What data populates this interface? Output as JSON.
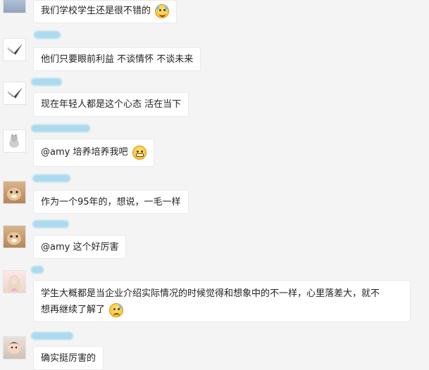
{
  "chat": {
    "messages": [
      {
        "text": "我们学校学生还是很不错的",
        "emoji": "laughing-tears-emoji",
        "avatar": "avatar-partial"
      },
      {
        "text": "他们只要眼前利益 不谈情怀 不谈未来",
        "avatar": "swallow-avatar"
      },
      {
        "text": "现在年轻人都是这个心态 活在当下",
        "avatar": "swallow-avatar"
      },
      {
        "text": "@amy 培养培养我吧",
        "emoji": "grinning-emoji",
        "avatar": "kitten-avatar"
      },
      {
        "text": "作为一个95年的，想说，一毛一样",
        "avatar": "hamster-avatar"
      },
      {
        "text": "@amy 这个好厉害",
        "avatar": "hamster-avatar"
      },
      {
        "text": "学生大概都是当企业介绍实际情况的时候觉得和想象中的不一样，心里落差大，就不想再继续了解了",
        "line1": "学生大概都是当企业介绍实际情况的时候觉得和想象中的不一样，心里落差大，就不",
        "line2": "想再继续了解了",
        "emoji": "sweat-smile-emoji",
        "avatar": "girl-avatar"
      },
      {
        "text": "确实挺厉害的",
        "avatar": "child-avatar"
      }
    ]
  },
  "colors": {
    "background": "#f4f4f4",
    "bubble": "#ffffff",
    "name_blur": "#9fd6ee"
  }
}
